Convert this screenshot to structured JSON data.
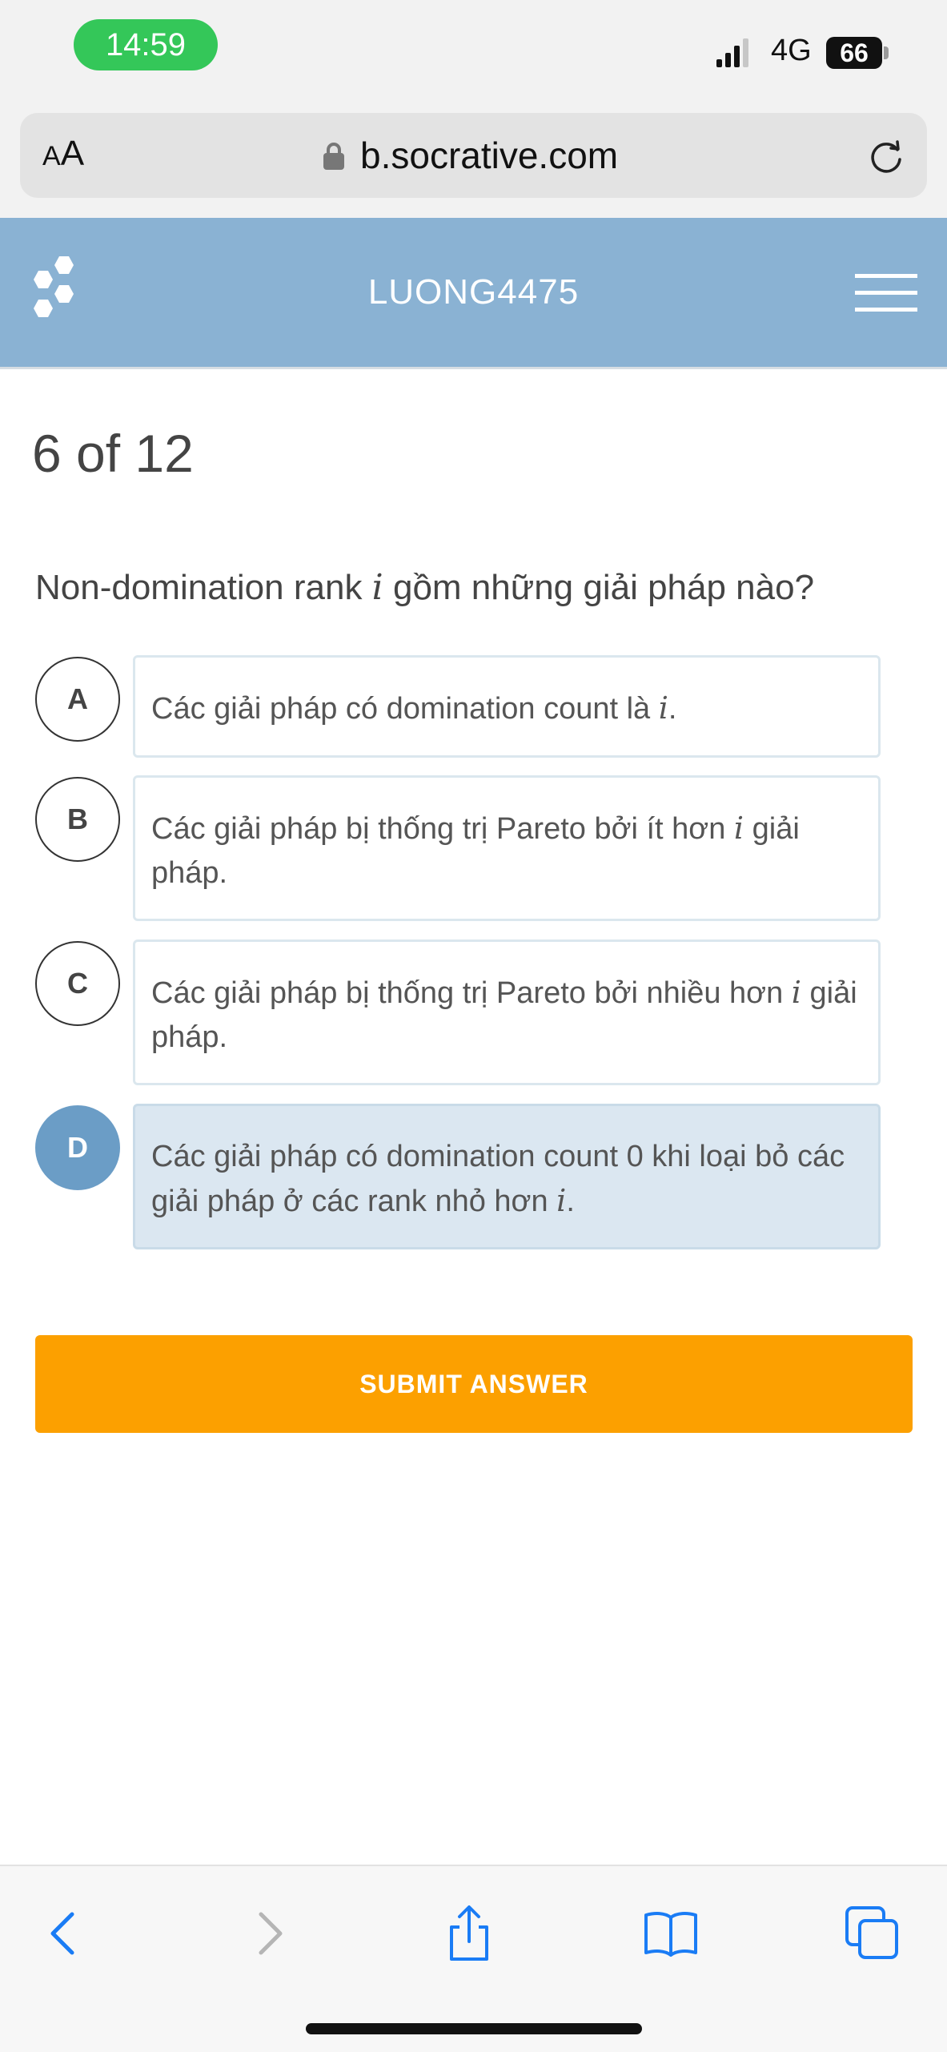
{
  "status_bar": {
    "time": "14:59",
    "network": "4G",
    "battery": "66",
    "icons": [
      "signal-icon",
      "battery-icon"
    ]
  },
  "browser": {
    "text_size_label_small": "A",
    "text_size_label_large": "A",
    "url": "b.socrative.com",
    "icons": [
      "lock-icon",
      "reload-icon"
    ]
  },
  "header": {
    "room_name": "LUONG4475",
    "background_color": "#8ab2d3",
    "icons": [
      "socrative-logo-icon",
      "hamburger-menu-icon"
    ]
  },
  "quiz": {
    "progress": "6 of 12",
    "question_prefix": "Non-domination rank ",
    "question_var": "i",
    "question_suffix": " gồm những giải pháp nào?",
    "options": [
      {
        "letter": "A",
        "text": "Các giải pháp có domination count là ",
        "var": "i",
        "tail": ".",
        "selected": false
      },
      {
        "letter": "B",
        "text": "Các giải pháp bị thống trị Pareto bởi ít hơn ",
        "var": "i",
        "tail": " giải pháp.",
        "selected": false
      },
      {
        "letter": "C",
        "text": "Các giải pháp bị thống trị Pareto bởi nhiều hơn ",
        "var": "i",
        "tail": " giải pháp.",
        "selected": false
      },
      {
        "letter": "D",
        "text": "Các giải pháp có domination count 0 khi loại bỏ các giải pháp ở các rank nhỏ hơn ",
        "var": "i",
        "tail": ".",
        "selected": true
      }
    ],
    "submit_label": "SUBMIT ANSWER",
    "submit_color": "#fca000",
    "selected_color": "#6b9dc6"
  },
  "toolbar": {
    "icons": [
      "back-arrow-icon",
      "forward-arrow-icon",
      "share-icon",
      "bookmarks-icon",
      "tabs-icon"
    ]
  }
}
